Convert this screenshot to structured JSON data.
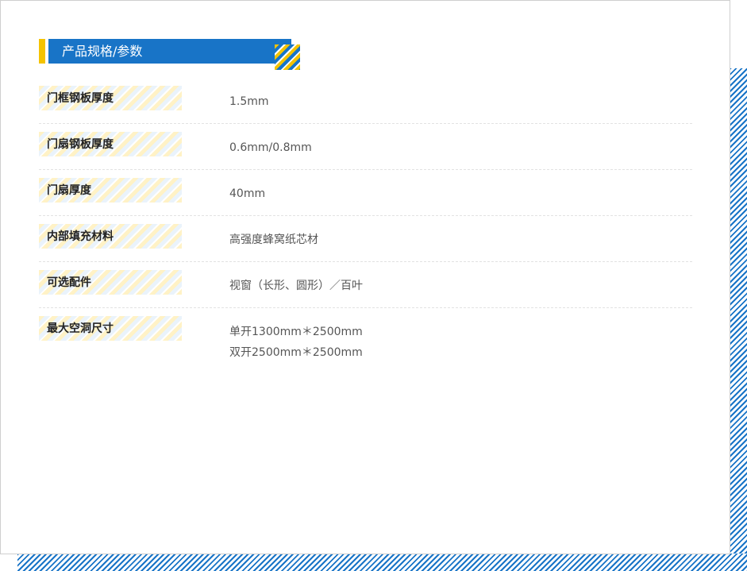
{
  "section": {
    "title": "产品规格/参数"
  },
  "specs": [
    {
      "label": "门框钢板厚度",
      "value_lines": [
        "1.5mm"
      ]
    },
    {
      "label": "门扇钢板厚度",
      "value_lines": [
        "0.6mm/0.8mm"
      ]
    },
    {
      "label": "门扇厚度",
      "value_lines": [
        "40mm"
      ]
    },
    {
      "label": "内部填充材料",
      "value_lines": [
        "高强度蜂窝纸芯材"
      ]
    },
    {
      "label": "可选配件",
      "value_lines": [
        "视窗（长形、圆形）／百叶"
      ]
    },
    {
      "label": "最大空洞尺寸",
      "value_lines": [
        "单开1300mm＊2500mm",
        "双开2500mm＊2500mm"
      ]
    }
  ],
  "colors": {
    "primary_blue": "#1874c7",
    "accent_yellow": "#f4c300",
    "label_text": "#222222",
    "value_text": "#555555"
  },
  "icons": {
    "title_ornament": "diagonal-stripe-corner-icon"
  }
}
